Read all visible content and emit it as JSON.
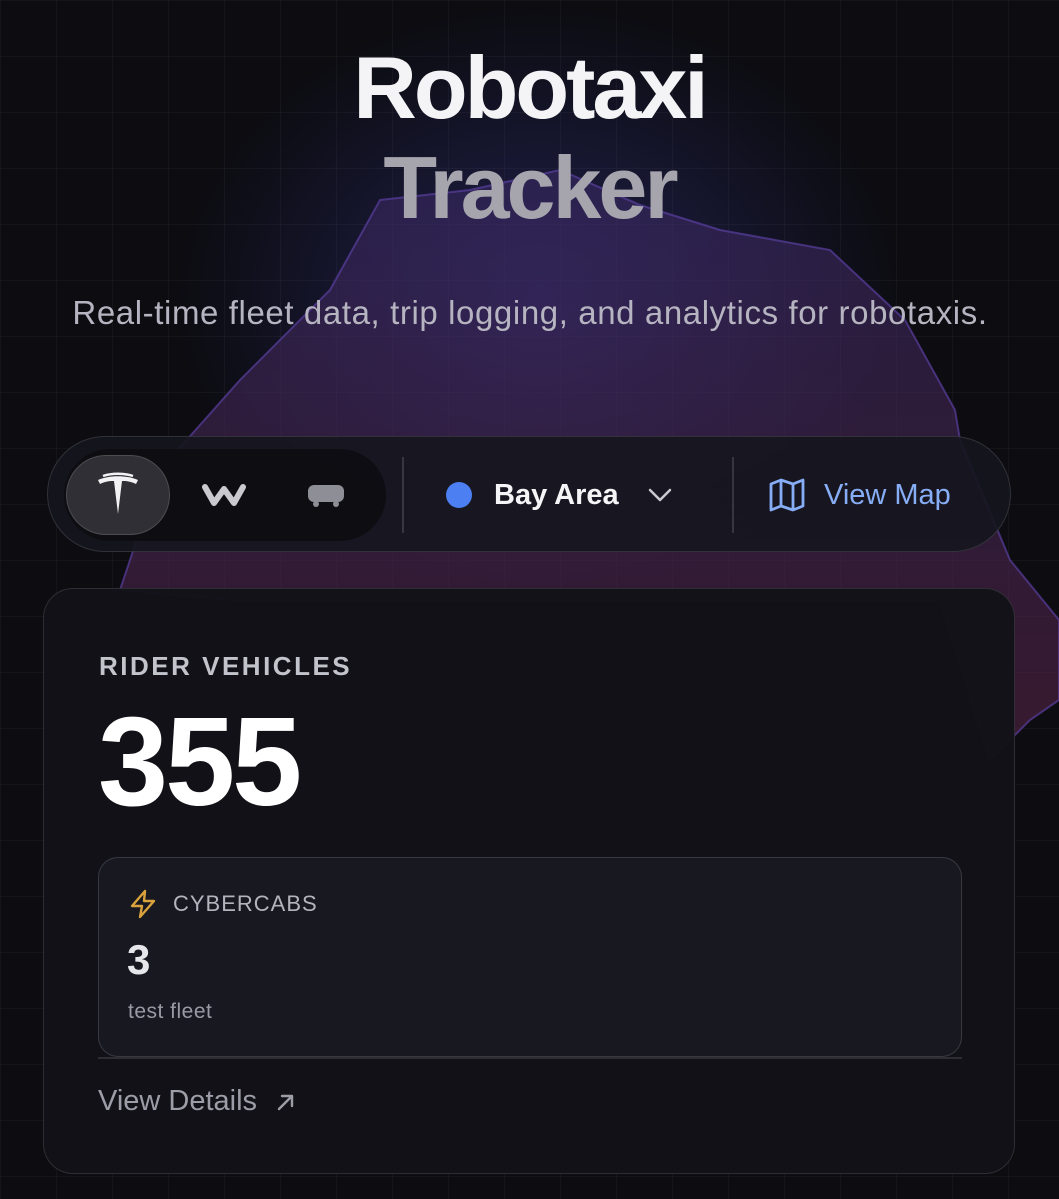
{
  "hero": {
    "title_line1": "Robotaxi",
    "title_line2": "Tracker",
    "subtitle": "Real-time fleet data, trip logging, and analytics for robotaxis."
  },
  "controls": {
    "providers": [
      {
        "icon": "tesla-logo-icon",
        "active": true
      },
      {
        "icon": "waymo-logo-icon",
        "active": false
      },
      {
        "icon": "zoox-vehicle-icon",
        "active": false
      }
    ],
    "region": {
      "label": "Bay Area",
      "dot_color": "#4c7ff2"
    },
    "view_map_label": "View Map",
    "accent": "#86adf5"
  },
  "stats": {
    "label": "RIDER VEHICLES",
    "value": "355",
    "cybercabs": {
      "icon": "lightning-bolt-icon",
      "label": "CYBERCABS",
      "value": "3",
      "note": "test fleet"
    },
    "view_details_label": "View Details"
  }
}
